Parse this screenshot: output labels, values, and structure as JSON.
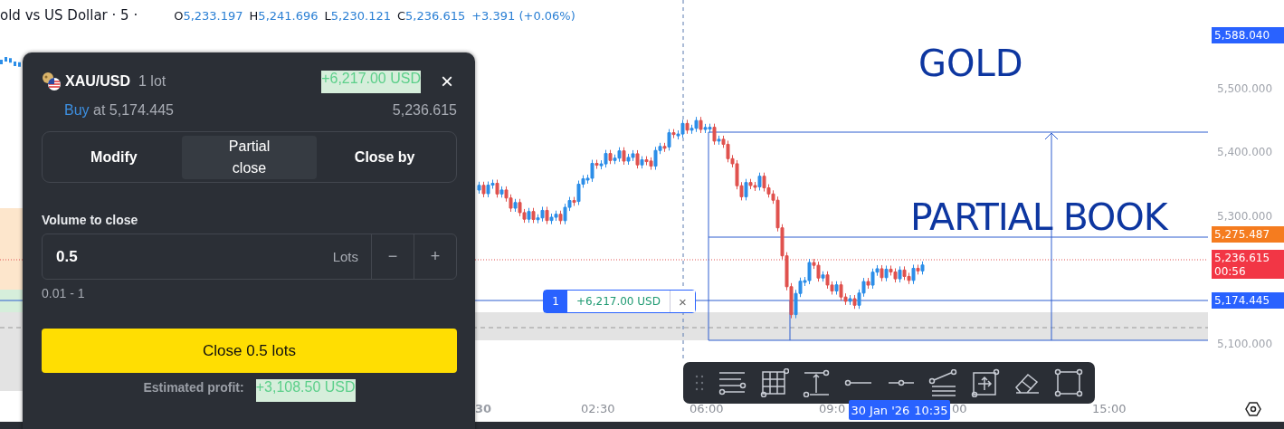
{
  "header": {
    "title": "old vs US Dollar · 5 ·",
    "ohlc": [
      {
        "label": "O",
        "value": "5,233.197"
      },
      {
        "label": "H",
        "value": "5,241.696"
      },
      {
        "label": "L",
        "value": "5,230.121"
      },
      {
        "label": "C",
        "value": "5,236.615"
      }
    ],
    "change": "+3.391 (+0.06%)"
  },
  "annotations": [
    {
      "text": "GOLD"
    },
    {
      "text": "PARTIAL BOOK"
    }
  ],
  "position_tag": {
    "count": "1",
    "pnl": "+6,217.00 USD",
    "close": "×"
  },
  "price_axis": {
    "ticks": [
      "5,500.000",
      "5,400.000",
      "5,300.000",
      "5,100.000"
    ],
    "labels": [
      {
        "value": "5,588.040",
        "color": "#2962ff"
      },
      {
        "value": "5,275.487",
        "color": "#f57c1f"
      },
      {
        "value": "5,236.615",
        "countdown": "00:56",
        "color": "#f23645"
      },
      {
        "value": "5,174.445",
        "color": "#2962ff"
      }
    ]
  },
  "time_axis": {
    "ticks": [
      {
        "text": "30",
        "kind": "day"
      },
      {
        "text": "02:30",
        "kind": "time"
      },
      {
        "text": "06:00",
        "kind": "time"
      },
      {
        "text": "09:0",
        "kind": "time"
      },
      {
        "text": "00",
        "kind": "time"
      },
      {
        "text": "15:00",
        "kind": "time"
      }
    ],
    "cursor_date": "30 Jan '26",
    "cursor_time": "10:35"
  },
  "panel": {
    "symbol": "XAU/USD",
    "size": "1 lot",
    "profit": "+6,217.00 USD",
    "close": "×",
    "side": "Buy",
    "entry": "at 5,174.445",
    "current": "5,236.615",
    "tabs": [
      {
        "label": "Modify",
        "selected": false
      },
      {
        "label": "Partial close",
        "selected": true
      },
      {
        "label": "Close by",
        "selected": false
      }
    ],
    "volume_label": "Volume to close",
    "volume": "0.5",
    "unit": "Lots",
    "minus": "−",
    "plus": "+",
    "range": "0.01 - 1",
    "submit": "Close 0.5 lots",
    "estimate_label": "Estimated profit:",
    "estimate": "+3,108.50 USD"
  }
}
